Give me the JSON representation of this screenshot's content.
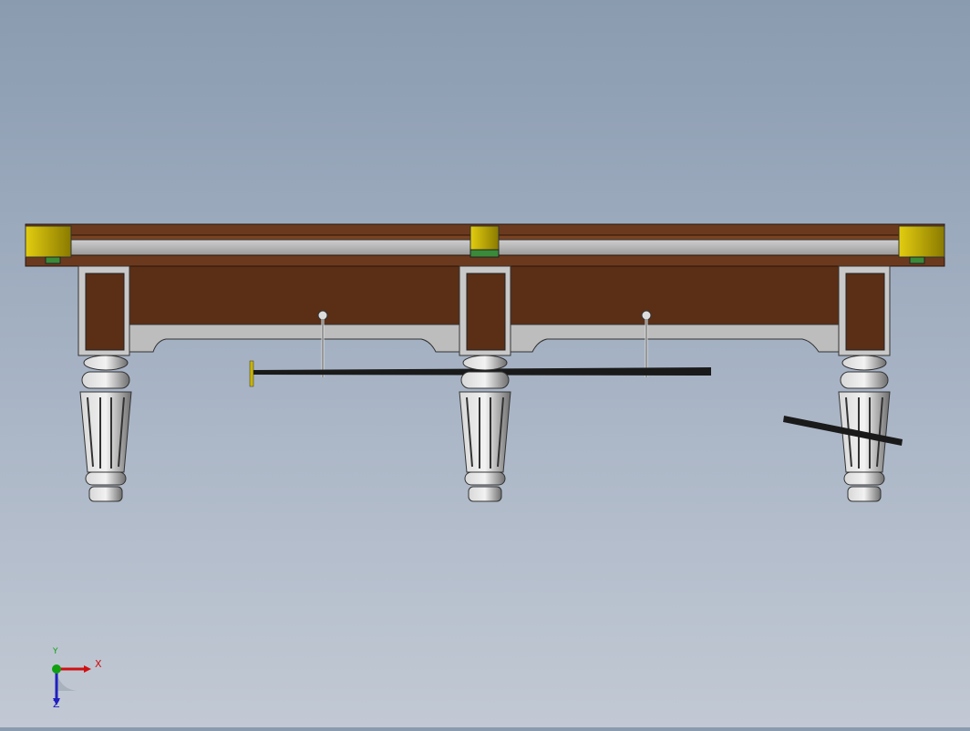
{
  "viewport": {
    "background_top": "#8a9bb0",
    "background_bottom": "#c2c9d4"
  },
  "model": {
    "wood_color": "#5a2f16",
    "trim_color": "#b5b5b5",
    "pocket_color": "#c9b300",
    "cloth_color": "#3a8a3a",
    "leg_color": "#9a9a9a"
  },
  "triad": {
    "x_label": "X",
    "y_label": "Y",
    "z_label": "Z",
    "x_color": "#d01010",
    "y_color": "#10a010",
    "z_color": "#2020c0"
  }
}
